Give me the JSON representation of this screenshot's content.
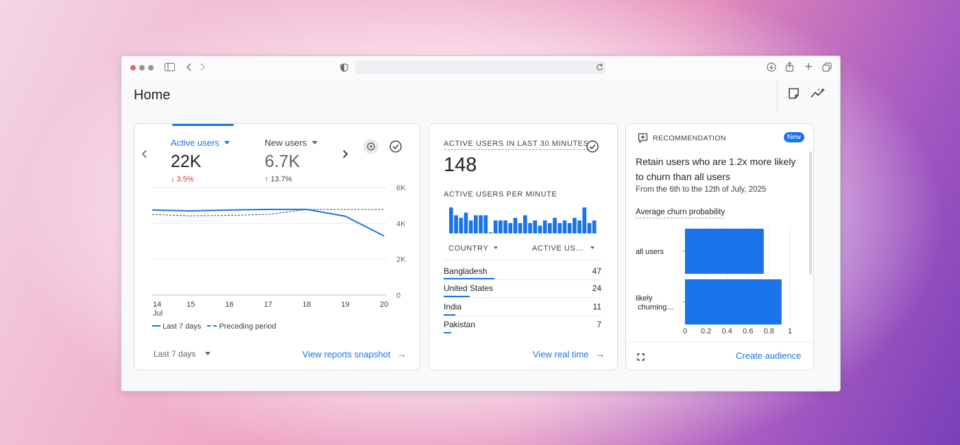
{
  "page": {
    "title": "Home"
  },
  "colors": {
    "accent": "#1a73e8",
    "negative": "#d93025"
  },
  "overview_card": {
    "metrics": [
      {
        "label": "Active users",
        "value": "22K",
        "change": "3.5%",
        "direction": "down",
        "selected": true
      },
      {
        "label": "New users",
        "value": "6.7K",
        "change": "13.7%",
        "direction": "up",
        "selected": false
      }
    ],
    "legend": {
      "current": "Last 7 days",
      "previous": "Preceding period"
    },
    "date_range": "Last 7 days",
    "link": "View reports snapshot"
  },
  "chart_data": {
    "type": "line",
    "x": [
      "14",
      "15",
      "16",
      "17",
      "18",
      "19",
      "20"
    ],
    "x_sublabel": "Jul",
    "ylim": [
      0,
      6000
    ],
    "yticks": [
      "6K",
      "4K",
      "2K",
      "0"
    ],
    "grid": true,
    "legend_position": "bottom-left",
    "series": [
      {
        "name": "Last 7 days",
        "style": "solid",
        "values": [
          4750,
          4700,
          4750,
          4780,
          4780,
          4400,
          3300
        ]
      },
      {
        "name": "Preceding period",
        "style": "dashed",
        "values": [
          4500,
          4420,
          4450,
          4500,
          4780,
          4780,
          4780
        ]
      }
    ]
  },
  "realtime_card": {
    "title": "ACTIVE USERS IN LAST 30 MINUTES",
    "value": "148",
    "per_minute_label": "ACTIVE USERS PER MINUTE",
    "per_minute_values": [
      10,
      7,
      6,
      8,
      5,
      7,
      7,
      7,
      0,
      5,
      5,
      5,
      4,
      6,
      4,
      7,
      4,
      5,
      3,
      5,
      4,
      6,
      4,
      5,
      4,
      6,
      5,
      10,
      4,
      5
    ],
    "table": {
      "col1": "COUNTRY",
      "col2": "ACTIVE US…",
      "rows": [
        {
          "name": "Bangladesh",
          "value": "47",
          "share": 1.0
        },
        {
          "name": "United States",
          "value": "24",
          "share": 0.51
        },
        {
          "name": "India",
          "value": "11",
          "share": 0.23
        },
        {
          "name": "Pakistan",
          "value": "7",
          "share": 0.15
        }
      ]
    },
    "link": "View real time"
  },
  "recommendation_card": {
    "header": "RECOMMENDATION",
    "badge": "New",
    "headline_line1": "Retain users who are 1.2x more likely",
    "headline_line2": "to churn than all users",
    "date_range": "From the 6th to the 12th of July, 2025",
    "chart_title": "Average churn probability",
    "bars": [
      {
        "label": "all users",
        "value": 0.75
      },
      {
        "label_line1": "likely",
        "label_line2": "churning…",
        "value": 0.92
      }
    ],
    "xticks": [
      "0",
      "0.2",
      "0.4",
      "0.6",
      "0.8",
      "1"
    ],
    "xlim": [
      0,
      1
    ],
    "link": "Create audience"
  }
}
